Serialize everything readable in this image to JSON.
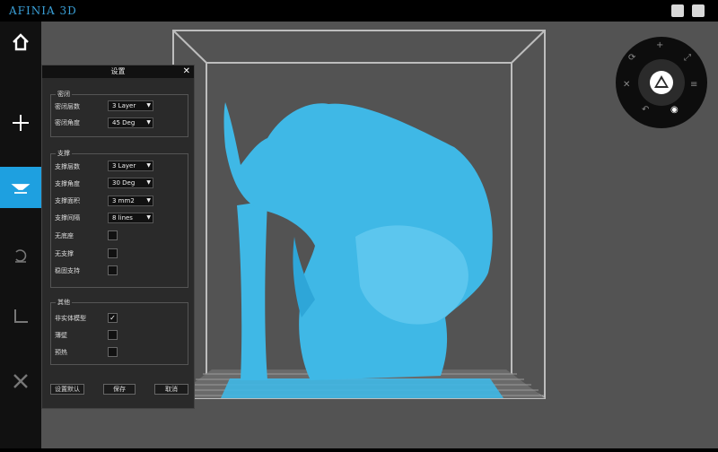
{
  "app": {
    "logo": "AFINIA 3D"
  },
  "topbar": {
    "icons": [
      "settings-key-icon",
      "tshirt-icon"
    ]
  },
  "sidebar": {
    "items": [
      {
        "name": "home-icon",
        "glyph": "⌂",
        "active": false
      },
      {
        "name": "add-icon",
        "glyph": "+",
        "active": false
      },
      {
        "name": "print-icon",
        "glyph": "▬",
        "active": true
      },
      {
        "name": "rotate-icon",
        "glyph": "⟲",
        "active": false
      },
      {
        "name": "calibrate-icon",
        "glyph": "∟",
        "active": false
      },
      {
        "name": "tools-icon",
        "glyph": "✕",
        "active": false
      }
    ]
  },
  "dialog": {
    "title": "设置",
    "close": "✕",
    "seal": {
      "title": "密闭",
      "layers_label": "密闭层数",
      "layers_value": "3 Layer",
      "angle_label": "密闭角度",
      "angle_value": "45 Deg"
    },
    "support": {
      "title": "支撑",
      "layers_label": "支撑层数",
      "layers_value": "3 Layer",
      "angle_label": "支撑角度",
      "angle_value": "30 Deg",
      "area_label": "支撑面积",
      "area_value": "3 mm2",
      "spacing_label": "支撑间隔",
      "spacing_value": "8 lines",
      "no_base_label": "无底座",
      "no_support_label": "无支撑",
      "stable_label": "稳固支持"
    },
    "other": {
      "title": "其他",
      "non_solid_label": "非实体模型",
      "non_solid_checked": "✓",
      "thin_wall_label": "薄壁",
      "preheat_label": "预热"
    },
    "buttons": {
      "defaults": "设置默认",
      "save": "保存",
      "cancel": "取消"
    }
  },
  "colors": {
    "accent": "#1ea0e0",
    "model": "#3fb8e6",
    "viewport": "#535353"
  }
}
